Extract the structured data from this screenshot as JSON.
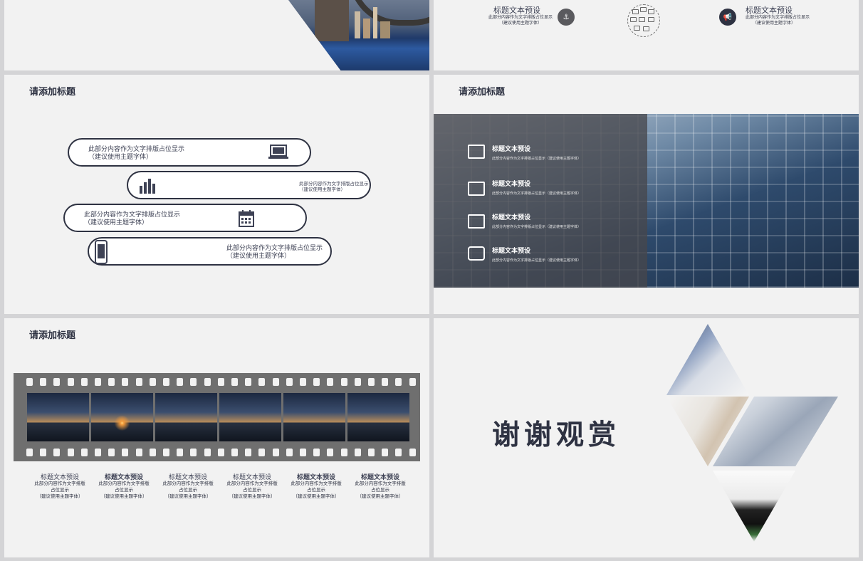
{
  "slide1": {},
  "slide2": {
    "left_block": {
      "title": "标题文本预设",
      "sub1": "此部分内容作为文字排版占位显示",
      "sub2": "（建议使用主题字体）"
    },
    "right_block": {
      "title": "标题文本预设",
      "sub1": "此部分内容作为文字排版占位显示",
      "sub2": "（建议使用主题字体）"
    },
    "left_icon": "anchor-icon",
    "right_icon": "megaphone-icon",
    "colors": {
      "left_icon_bg": "#5a5a5e",
      "right_icon_bg": "#2e3242"
    }
  },
  "slide3": {
    "title": "请添加标题",
    "items": [
      {
        "text1": "此部分内容作为文字排版占位显示",
        "text2": "（建议使用主题字体）",
        "icon": "laptop-icon"
      },
      {
        "text1": "此部分内容作为文字排版占位显示",
        "text2": "（建议使用主题字体）",
        "icon": "bar-chart-icon"
      },
      {
        "text1": "此部分内容作为文字排版占位显示",
        "text2": "（建议使用主题字体）",
        "icon": "calendar-icon"
      },
      {
        "text1": "此部分内容作为文字排版占位显示",
        "text2": "（建议使用主题字体）",
        "icon": "phone-icon"
      }
    ]
  },
  "slide4": {
    "title": "请添加标题",
    "items": [
      {
        "title": "标题文本预设",
        "sub": "此部分内容作为文字排版占位显示（建议使用主题字体）",
        "icon": "monitor-chart-icon"
      },
      {
        "title": "标题文本预设",
        "sub": "此部分内容作为文字排版占位显示（建议使用主题字体）",
        "icon": "id-card-icon"
      },
      {
        "title": "标题文本预设",
        "sub": "此部分内容作为文字排版占位显示（建议使用主题字体）",
        "icon": "bar-monitor-icon"
      },
      {
        "title": "标题文本预设",
        "sub": "此部分内容作为文字排版占位显示（建议使用主题字体）",
        "icon": "camera-icon"
      }
    ]
  },
  "slide5": {
    "title": "请添加标题",
    "captions": [
      {
        "title": "标题文本预设",
        "l1": "此部分内容作为文字排版",
        "l2": "占位显示",
        "l3": "（建议使用主题字体）"
      },
      {
        "title": "标题文本预设",
        "l1": "此部分内容作为文字排版",
        "l2": "占位显示",
        "l3": "（建议使用主题字体）"
      },
      {
        "title": "标题文本预设",
        "l1": "此部分内容作为文字排版",
        "l2": "占位显示",
        "l3": "（建议使用主题字体）"
      },
      {
        "title": "标题文本预设",
        "l1": "此部分内容作为文字排版",
        "l2": "占位显示",
        "l3": "（建议使用主题字体）"
      },
      {
        "title": "标题文本预设",
        "l1": "此部分内容作为文字排版",
        "l2": "占位显示",
        "l3": "（建议使用主题字体）"
      },
      {
        "title": "标题文本预设",
        "l1": "此部分内容作为文字排版",
        "l2": "占位显示",
        "l3": "（建议使用主题字体）"
      }
    ]
  },
  "slide6": {
    "thanks": "谢谢观赏"
  },
  "colors": {
    "primary": "#2e3242",
    "slide_bg": "#f2f2f2",
    "page_bg": "#d4d4d6",
    "film": "#6f6f6f"
  }
}
